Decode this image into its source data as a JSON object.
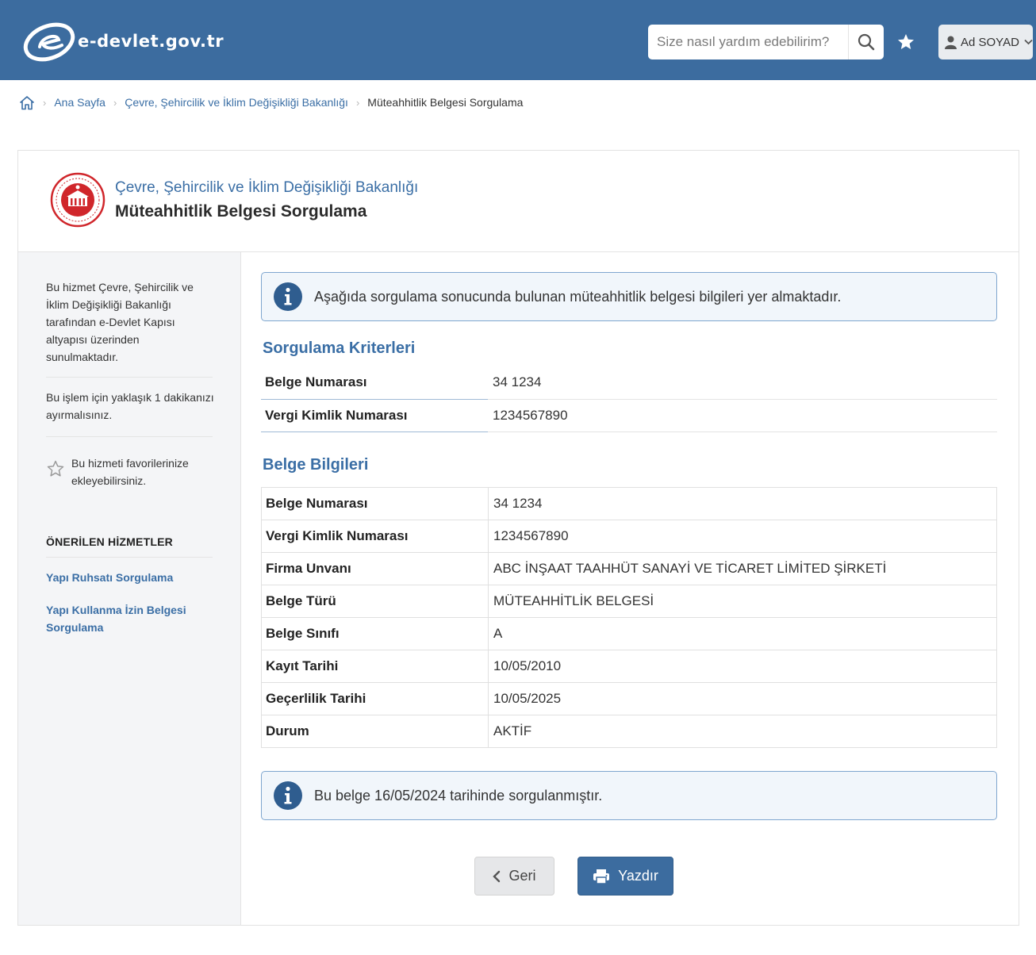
{
  "header": {
    "logo_text": "e-devlet.gov.tr",
    "search_placeholder": "Size nasıl yardım edebilirim?",
    "user_name": "Ad SOYAD"
  },
  "breadcrumb": {
    "items": [
      "Ana Sayfa",
      "Çevre, Şehircilik ve İklim Değişikliği Bakanlığı",
      "Müteahhitlik Belgesi Sorgulama"
    ]
  },
  "service": {
    "ministry": "Çevre, Şehircilik ve İklim Değişikliği Bakanlığı",
    "title": "Müteahhitlik Belgesi Sorgulama"
  },
  "sidebar": {
    "info_lines": [
      "Bu hizmet Çevre, Şehircilik ve",
      "İklim Değişikliği Bakanlığı",
      "tarafından e-Devlet Kapısı",
      "altyapısı üzerinden",
      "sunulmaktadır."
    ],
    "duration_lines": [
      "Bu işlem için yaklaşık 1 dakikanızı",
      "ayırmalısınız."
    ],
    "favorite_lines": [
      "Bu hizmeti favorilerinize",
      "ekleyebilirsiniz."
    ],
    "recommended_heading": "ÖNERİLEN HİZMETLER",
    "links": [
      {
        "lines": [
          "Yapı Ruhsatı Sorgulama"
        ]
      },
      {
        "lines": [
          "Yapı Kullanma İzin Belgesi",
          "Sorgulama"
        ]
      }
    ]
  },
  "alert_top": "Aşağıda sorgulama sonucunda bulunan müteahhitlik belgesi bilgileri yer almaktadır.",
  "criteria": {
    "title": "Sorgulama Kriterleri",
    "rows": [
      {
        "label": "Belge Numarası",
        "value": "34 1234"
      },
      {
        "label": "Vergi Kimlik Numarası",
        "value": "1234567890"
      }
    ]
  },
  "certificate": {
    "title": "Belge Bilgileri",
    "rows": [
      {
        "label": "Belge Numarası",
        "value": "34 1234"
      },
      {
        "label": "Vergi Kimlik Numarası",
        "value": "1234567890"
      },
      {
        "label": "Firma Unvanı",
        "value": "ABC İNŞAAT TAAHHÜT SANAYİ VE TİCARET LİMİTED ŞİRKETİ"
      },
      {
        "label": "Belge Türü",
        "value": "MÜTEAHHİTLİK BELGESİ"
      },
      {
        "label": "Belge Sınıfı",
        "value": "A"
      },
      {
        "label": "Kayıt Tarihi",
        "value": "10/05/2010"
      },
      {
        "label": "Geçerlilik Tarihi",
        "value": "10/05/2025"
      },
      {
        "label": "Durum",
        "value": "AKTİF"
      }
    ]
  },
  "alert_bottom": "Bu belge 16/05/2024 tarihinde sorgulanmıştır.",
  "buttons": {
    "back": "Geri",
    "print": "Yazdır"
  },
  "colors": {
    "header_bg": "#3c6c9f",
    "accent": "#3a6ea5",
    "sidebar_bg": "#f4f5f7"
  },
  "icons": [
    "search-icon",
    "star-icon",
    "user-icon",
    "chevron-down-icon",
    "home-icon",
    "info-icon",
    "chevron-left-icon",
    "printer-icon",
    "ministry-seal"
  ]
}
